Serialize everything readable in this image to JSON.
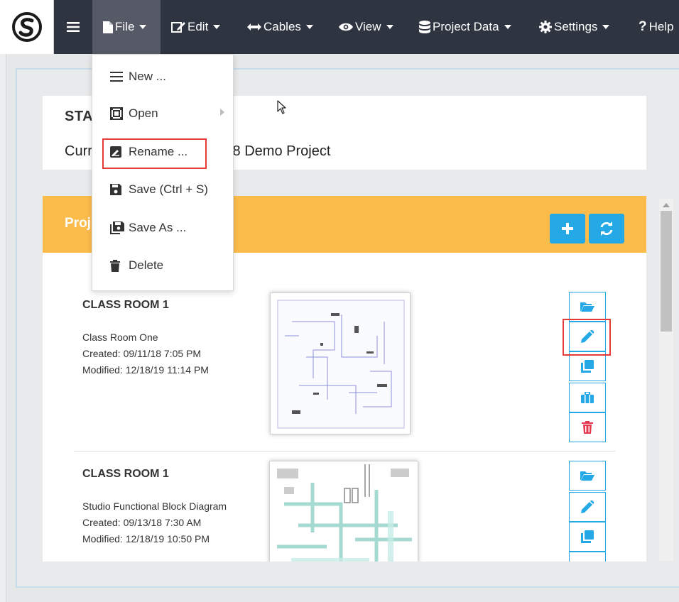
{
  "navbar": {
    "menu": [
      {
        "label": "File",
        "icon": "file-icon"
      },
      {
        "label": "Edit",
        "icon": "edit-icon"
      },
      {
        "label": "Cables",
        "icon": "arrows-h-icon"
      },
      {
        "label": "View",
        "icon": "eye-icon"
      },
      {
        "label": "Project Data",
        "icon": "database-icon"
      },
      {
        "label": "Settings",
        "icon": "gear-icon"
      },
      {
        "label": "Help",
        "icon": "question-icon"
      }
    ]
  },
  "file_menu": {
    "items": [
      {
        "label": "New ...",
        "icon": "list-icon"
      },
      {
        "label": "Open",
        "icon": "open-icon",
        "has_submenu": true
      },
      {
        "label": "Rename ...",
        "icon": "rename-icon",
        "highlighted": true
      },
      {
        "label": "Save (Ctrl + S)",
        "icon": "save-icon"
      },
      {
        "label": "Save As ...",
        "icon": "save-as-icon"
      },
      {
        "label": "Delete",
        "icon": "trash-icon"
      }
    ]
  },
  "status": {
    "title": "STA",
    "current_label": "Curr",
    "current_value": ".8 Demo Project"
  },
  "projects": {
    "title": "Proj",
    "items": [
      {
        "name": "CLASS ROOM 1",
        "description": "Class Room One",
        "created": "Created: 09/11/18 7:05 PM",
        "modified": "Modified: 12/18/19 11:14 PM"
      },
      {
        "name": "CLASS ROOM 1",
        "description": "Studio Functional Block Diagram",
        "created": "Created: 09/13/18 7:30 AM",
        "modified": "Modified: 12/18/19 10:50 PM"
      }
    ]
  },
  "colors": {
    "navbar": "#2f3441",
    "accent": "#25a8e6",
    "header": "#fcbc4c",
    "danger": "#e53935",
    "highlight": "#e53935"
  }
}
